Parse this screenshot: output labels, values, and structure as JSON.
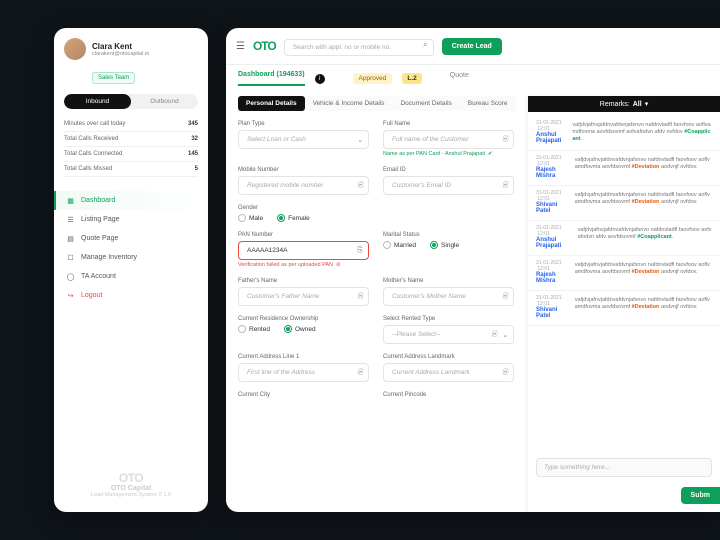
{
  "user": {
    "name": "Clara Kent",
    "email": "clarakent@otocapital.in",
    "team": "Sales Team"
  },
  "toggle": {
    "inbound": "Inbound",
    "outbound": "Outbound"
  },
  "stats": [
    {
      "label": "Minutes over call today",
      "value": "345"
    },
    {
      "label": "Total Calls Received",
      "value": "32"
    },
    {
      "label": "Total Calls Connected",
      "value": "145"
    },
    {
      "label": "Total Calls Missed",
      "value": "5"
    }
  ],
  "nav": {
    "dashboard": "Dashboard",
    "listing": "Listing Page",
    "quote": "Quote Page",
    "inventory": "Manage Inventory",
    "ta": "TA Account",
    "logout": "Logout"
  },
  "brand": {
    "name": "OTO Capital",
    "sub": "Lead Management System V 1.0",
    "logo": "OTO"
  },
  "topbar": {
    "search_ph": "Search with appl. no or mobile no.",
    "create": "Create Lead"
  },
  "tabs": {
    "dashboard": "Dashboard (194633)",
    "approved": "Approved",
    "l2": "L.2",
    "quote": "Quote"
  },
  "subtabs": {
    "personal": "Personal Details",
    "vehicle": "Vehicle & Income Details",
    "document": "Document Details",
    "bureau": "Bureau Score"
  },
  "form": {
    "plan_lbl": "Plan Type",
    "plan_ph": "Select Loan or Cash",
    "fullname_lbl": "Full Name",
    "fullname_ph": "Full name of the Customer",
    "pan_ok": "Name as per PAN Card - Anshul Prajapati",
    "mobile_lbl": "Mobile Number",
    "mobile_ph": "Registered mobile number",
    "email_lbl": "Email ID",
    "email_ph": "Customer's Email ID",
    "gender_lbl": "Gender",
    "male": "Male",
    "female": "Female",
    "pan_lbl": "PAN Number",
    "pan_val": "AAAAA1234A",
    "pan_err": "Verification failed as per uploaded PAN",
    "marital_lbl": "Marital Status",
    "married": "Married",
    "single": "Single",
    "father_lbl": "Father's Name",
    "father_ph": "Customer's Father Name",
    "mother_lbl": "Mother's Name",
    "mother_ph": "Customer's Mother Name",
    "residence_lbl": "Current Residence Ownership",
    "rented": "Rented",
    "owned": "Owned",
    "renttype_lbl": "Select Rented Type",
    "renttype_ph": "--Please Select--",
    "addr1_lbl": "Current Address Line 1",
    "addr1_ph": "First line of the Address",
    "landmark_lbl": "Current Address Landmark",
    "landmark_ph": "Current Address Landmark",
    "city_lbl": "Current City",
    "pincode_lbl": "Current Pincode"
  },
  "remarks": {
    "header": "Remarks:",
    "filter": "All",
    "input_ph": "Type something here...",
    "submit": "Subm",
    "items": [
      {
        "date": "31-01-2021",
        "time": "12:01",
        "user": "Anshul Prajapati",
        "text": "vafjdvjafnvjafdnvafdvnjafsnvo nafdnvladfl faovfoov aoflvamdfovma aovfdsovmf aofvafodvn afdv ovfdov #Coapplicant."
      },
      {
        "date": "31-01-2021",
        "time": "12:01",
        "user": "Rajesh Mishra",
        "text": "vafjdvjafnvjafdnvafdvnjafsnvo nafdnvladfl faovfoov aoflvamdfovma aovfdsovmf #Deviation aodvnjf ovfdov."
      },
      {
        "date": "31-01-2021",
        "time": "12:01",
        "user": "Shivani Patel",
        "text": "vafjdvjafnvjafdnvafdvnjafsnvo nafdnvladfl faovfoov aoflvamdfovma aovfdsovmf #Deviation aodvnjf ovfdov."
      },
      {
        "date": "31-01-2021",
        "time": "12:01",
        "user": "Anshul Prajapati",
        "text": "vafjdvjafnvjafdnvafdvnjafsnvo nafdnvladfl faovfoov aofvafodvn afdv aovfdsovmf #Coapplicant."
      },
      {
        "date": "31-01-2021",
        "time": "12:01",
        "user": "Rajesh Mishra",
        "text": "vafjdvjafnvjafdnvafdvnjafsnvo nafdnvladfl faovfoov aoflvamdfovma aovfdsovmf #Deviation aodvnjf ovfdov."
      },
      {
        "date": "31-01-2021",
        "time": "12:01",
        "user": "Shivani Patel",
        "text": "vafjdvjafnvjafdnvafdvnjafsnvo nafdnvladfl faovfoov aoflvamdfovma aovfdsovmf #Deviation aodvnjf ovfdov."
      }
    ]
  }
}
